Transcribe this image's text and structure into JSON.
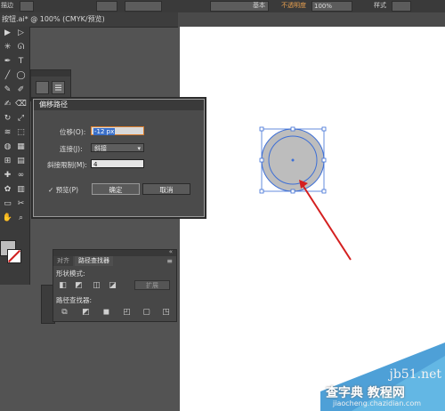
{
  "app": {
    "topbar": {
      "control_label": "描边",
      "stroke_style": "基本",
      "opacity_label": "不透明度",
      "opacity_value": "100%",
      "style_label": "样式"
    },
    "doc_tab": "按钮.ai* @ 100% (CMYK/预览)"
  },
  "dialog": {
    "title": "偏移路径",
    "offset_label": "位移(O):",
    "offset_value": "-12 px",
    "join_label": "连接(J):",
    "join_value": "斜接",
    "miter_label": "斜接限制(M):",
    "miter_value": "4",
    "preview_label": "预览(P)",
    "preview_checked": true,
    "ok_label": "确定",
    "cancel_label": "取消"
  },
  "pathfinder_panel": {
    "tabs": [
      "对齐",
      "路径查找器"
    ],
    "active_tab": "路径查找器",
    "shape_modes_label": "形状模式:",
    "expand_label": "扩展",
    "pathfinders_label": "路径查找器:"
  },
  "canvas": {
    "circle_fill": "#bdbdbd",
    "selection_color": "#3d6fd6",
    "arrow_color": "#d42020"
  },
  "icons": {
    "tools": [
      "selection-tool-icon",
      "direct-selection-tool-icon",
      "magic-wand-icon",
      "lasso-icon",
      "pen-tool-icon",
      "type-tool-icon",
      "line-tool-icon",
      "ellipse-tool-icon",
      "paintbrush-icon",
      "pencil-icon",
      "blob-brush-icon",
      "eraser-icon",
      "rotate-tool-icon",
      "scale-tool-icon",
      "width-tool-icon",
      "free-transform-icon",
      "shape-builder-icon",
      "perspective-grid-icon",
      "mesh-tool-icon",
      "gradient-tool-icon",
      "eyedropper-icon",
      "blend-tool-icon",
      "symbol-sprayer-icon",
      "column-graph-icon",
      "artboard-tool-icon",
      "slice-tool-icon",
      "hand-tool-icon",
      "zoom-tool-icon"
    ]
  },
  "watermark": {
    "site": "jb51.net",
    "brand": "查字典 教程网",
    "url": "jiaocheng.chazidian.com"
  }
}
